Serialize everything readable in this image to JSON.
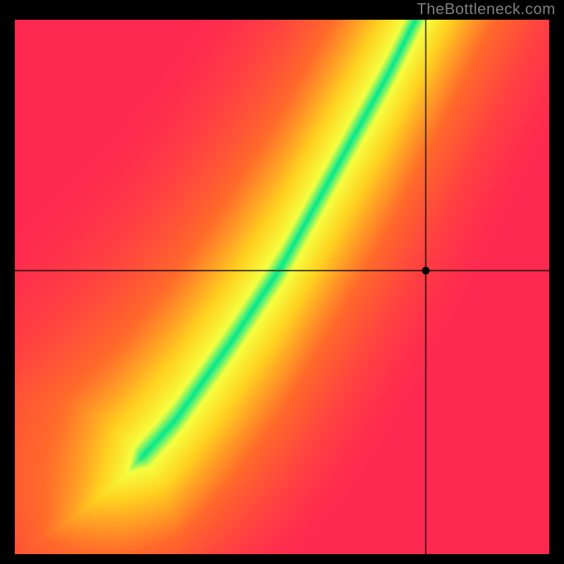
{
  "watermark": "TheBottleneck.com",
  "chart_data": {
    "type": "heatmap",
    "title": "",
    "xlabel": "",
    "ylabel": "",
    "xlim": [
      0,
      100
    ],
    "ylim": [
      0,
      100
    ],
    "crosshair": {
      "x": 77,
      "y": 53
    },
    "marker": {
      "x": 77,
      "y": 53
    },
    "optimal_curve": [
      {
        "x": 0,
        "y": 0
      },
      {
        "x": 10,
        "y": 6
      },
      {
        "x": 20,
        "y": 14
      },
      {
        "x": 30,
        "y": 25
      },
      {
        "x": 40,
        "y": 39
      },
      {
        "x": 50,
        "y": 54
      },
      {
        "x": 60,
        "y": 72
      },
      {
        "x": 70,
        "y": 90
      },
      {
        "x": 75,
        "y": 100
      }
    ],
    "color_stops": [
      {
        "t": 0.0,
        "color": "#ff2850"
      },
      {
        "t": 0.4,
        "color": "#ff6a2a"
      },
      {
        "t": 0.7,
        "color": "#ffd020"
      },
      {
        "t": 0.9,
        "color": "#f5ff40"
      },
      {
        "t": 1.0,
        "color": "#00e890"
      }
    ]
  }
}
